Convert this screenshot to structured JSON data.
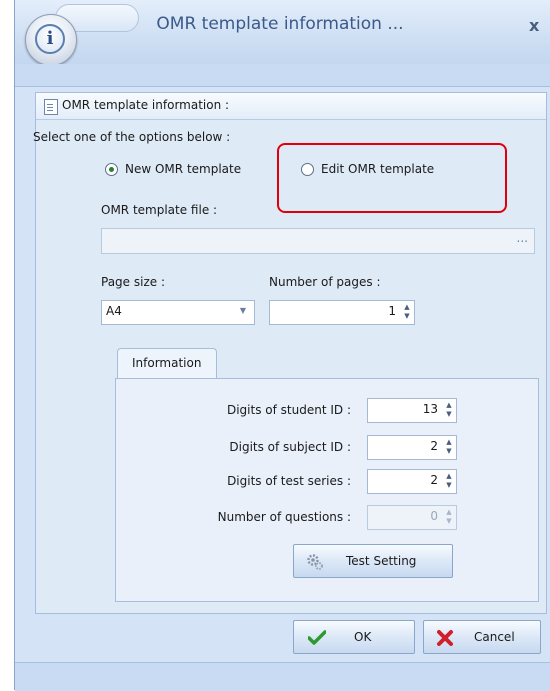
{
  "window": {
    "title": "OMR template information ...",
    "close_label": "x"
  },
  "group": {
    "title": "OMR template information :"
  },
  "options": {
    "prompt": "Select one of the options below :",
    "new_label": "New OMR template",
    "edit_label": "Edit OMR template",
    "selected": "new"
  },
  "template_file": {
    "label": "OMR template file :",
    "value": "",
    "browse_label": "..."
  },
  "page_size": {
    "label": "Page size :",
    "value": "A4"
  },
  "number_of_pages": {
    "label": "Number of pages :",
    "value": "1"
  },
  "info_tab": {
    "label": "Information",
    "fields": [
      {
        "label": "Digits of student ID :",
        "value": "13",
        "enabled": true
      },
      {
        "label": "Digits of subject ID :",
        "value": "2",
        "enabled": true
      },
      {
        "label": "Digits of test series :",
        "value": "2",
        "enabled": true
      },
      {
        "label": "Number of questions :",
        "value": "0",
        "enabled": false
      }
    ],
    "test_setting_label": "Test Setting"
  },
  "buttons": {
    "ok_label": "OK",
    "cancel_label": "Cancel"
  },
  "icons": {
    "app": "info-icon",
    "doc": "document-icon",
    "gear": "gears-icon",
    "ok": "checkmark-icon",
    "cancel": "red-x-icon"
  },
  "colors": {
    "highlight": "#e0000a",
    "ok_check": "#2e9a2e",
    "cancel_x": "#d0202a",
    "title_text": "#3a5a8a"
  }
}
